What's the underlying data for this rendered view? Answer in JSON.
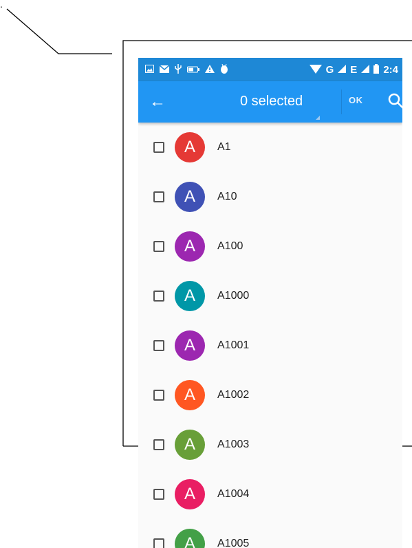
{
  "statusbar": {
    "left_icons": [
      "image-icon",
      "mail-icon",
      "usb-icon",
      "battery-saver-icon",
      "warning-icon",
      "android-icon"
    ],
    "network": "G",
    "network2": "E",
    "time": "2:4"
  },
  "toolbar": {
    "back_icon": "←",
    "title": "0 selected",
    "ok_label": "OK",
    "bg_color": "#2196f3",
    "statusbar_color": "#1e88d6"
  },
  "contacts": [
    {
      "initial": "A",
      "name": "A1",
      "color": "#e53935"
    },
    {
      "initial": "A",
      "name": "A10",
      "color": "#3f51b5"
    },
    {
      "initial": "A",
      "name": "A100",
      "color": "#9c27b0"
    },
    {
      "initial": "A",
      "name": "A1000",
      "color": "#0097a7"
    },
    {
      "initial": "A",
      "name": "A1001",
      "color": "#9c27b0"
    },
    {
      "initial": "A",
      "name": "A1002",
      "color": "#ff5722"
    },
    {
      "initial": "A",
      "name": "A1003",
      "color": "#689f38"
    },
    {
      "initial": "A",
      "name": "A1004",
      "color": "#e91e63"
    },
    {
      "initial": "A",
      "name": "A1005",
      "color": "#43a047"
    }
  ]
}
